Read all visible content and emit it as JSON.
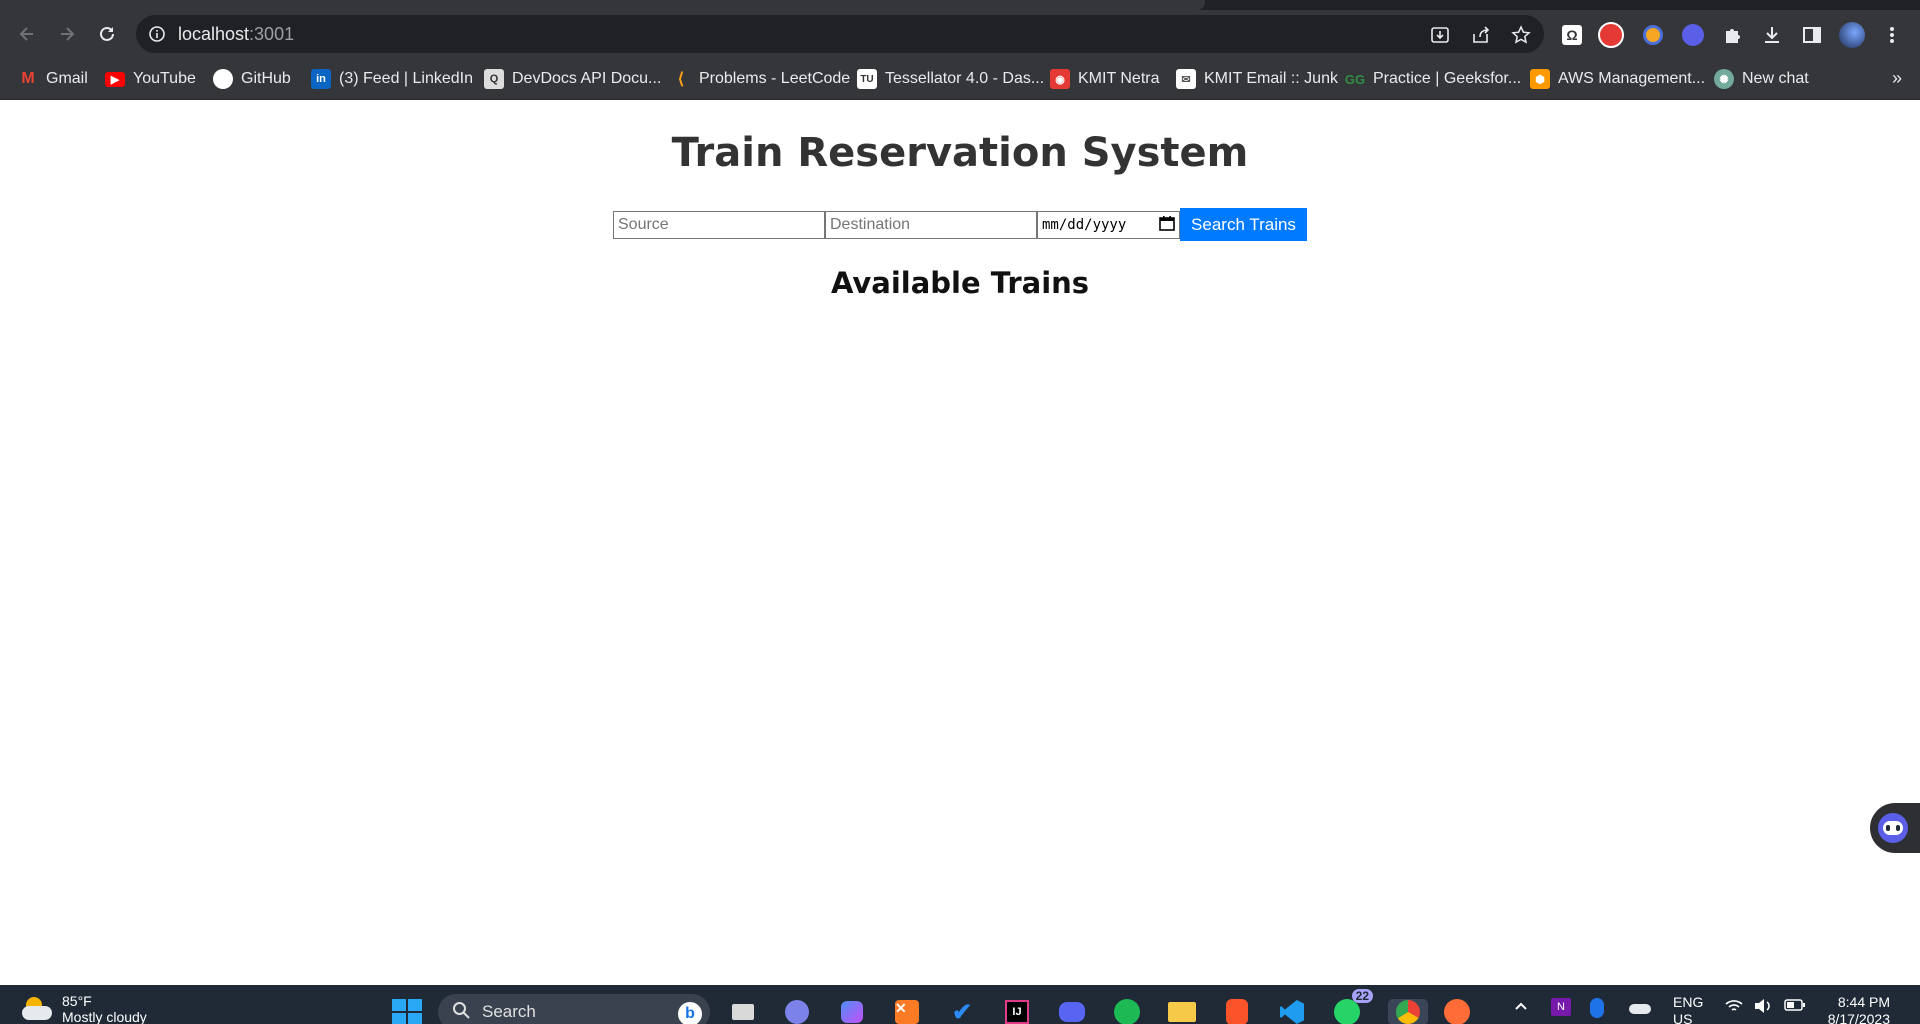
{
  "browser": {
    "url_host": "localhost",
    "url_port": ":3001",
    "bookmarks": [
      {
        "label": "Gmail",
        "icon": "gmail-icon",
        "color": "#ea4335"
      },
      {
        "label": "YouTube",
        "icon": "youtube-icon",
        "color": "#ff0000"
      },
      {
        "label": "GitHub",
        "icon": "github-icon",
        "color": "#ffffff"
      },
      {
        "label": "(3) Feed | LinkedIn",
        "icon": "linkedin-icon",
        "color": "#0a66c2"
      },
      {
        "label": "DevDocs API Docu...",
        "icon": "devdocs-icon",
        "color": "#dddddd"
      },
      {
        "label": "Problems - LeetCode",
        "icon": "leetcode-icon",
        "color": "#ffa116"
      },
      {
        "label": "Tessellator 4.0 - Das...",
        "icon": "tessellator-icon",
        "color": "#ffffff"
      },
      {
        "label": "KMIT Netra",
        "icon": "kmit-netra-icon",
        "color": "#e53935"
      },
      {
        "label": "KMIT Email :: Junk",
        "icon": "kmit-email-icon",
        "color": "#ffffff"
      },
      {
        "label": "Practice | Geeksfor...",
        "icon": "geeksforgeeks-icon",
        "color": "#2f8d46"
      },
      {
        "label": "AWS Management...",
        "icon": "aws-icon",
        "color": "#ff9900"
      },
      {
        "label": "New chat",
        "icon": "chatgpt-icon",
        "color": "#74aa9c"
      }
    ],
    "more_label": "»"
  },
  "page": {
    "title": "Train Reservation System",
    "source_placeholder": "Source",
    "destination_placeholder": "Destination",
    "date_placeholder": "mm/dd/yyyy",
    "search_label": "Search Trains",
    "results_heading": "Available Trains",
    "accent_color": "#007bff"
  },
  "taskbar": {
    "weather_temp": "85°F",
    "weather_desc": "Mostly cloudy",
    "search_label": "Search",
    "whatsapp_badge": "22",
    "language_top": "ENG",
    "language_bottom": "US",
    "time": "8:44 PM",
    "date": "8/17/2023"
  }
}
